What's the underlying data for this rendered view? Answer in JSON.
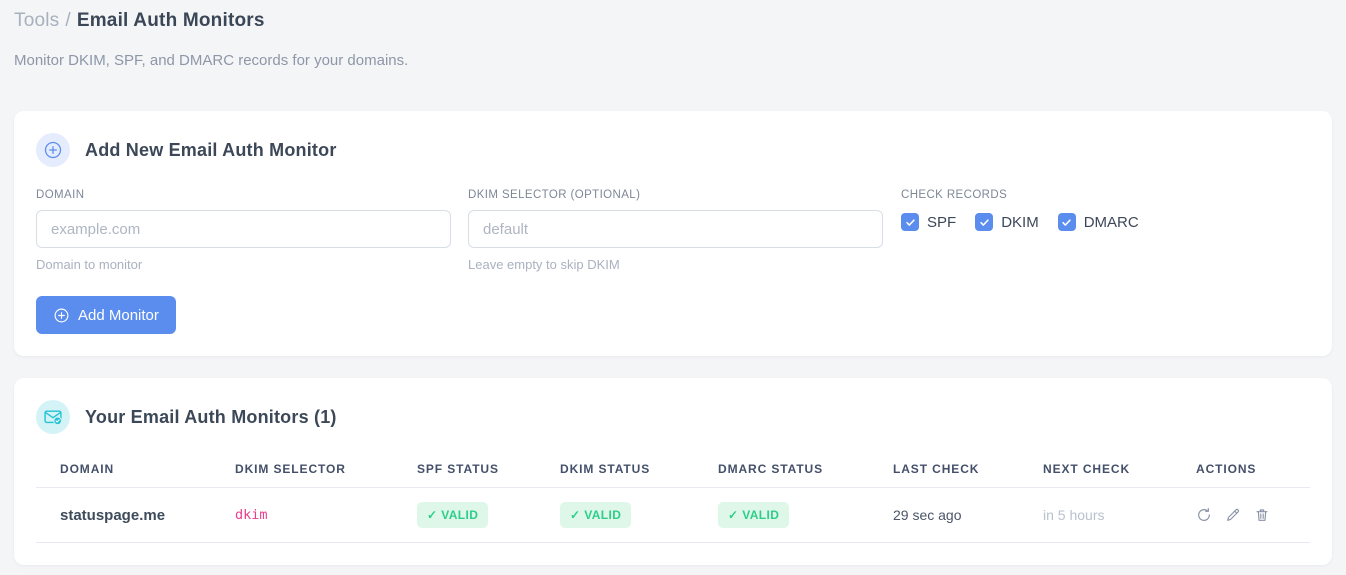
{
  "colors": {
    "accent_blue": "#5a8dee",
    "accent_teal": "#25c2d6",
    "success_text": "#2dce89",
    "success_bg": "#def7e9",
    "code_pink": "#e83e8c",
    "page_bg": "#f4f5f7"
  },
  "breadcrumb": {
    "section": "Tools",
    "separator": "/",
    "current": "Email Auth Monitors"
  },
  "page_subtitle": "Monitor DKIM, SPF, and DMARC records for your domains.",
  "add_monitor_card": {
    "title": "Add New Email Auth Monitor",
    "icon": "plus-circle-icon",
    "fields": {
      "domain": {
        "label": "DOMAIN",
        "value": "",
        "placeholder": "example.com",
        "helper": "Domain to monitor"
      },
      "dkim_selector": {
        "label": "DKIM SELECTOR (OPTIONAL)",
        "value": "",
        "placeholder": "default",
        "helper": "Leave empty to skip DKIM"
      }
    },
    "check_records": {
      "label": "CHECK RECORDS",
      "options": [
        {
          "label": "SPF",
          "checked": true
        },
        {
          "label": "DKIM",
          "checked": true
        },
        {
          "label": "DMARC",
          "checked": true
        }
      ]
    },
    "submit_label": "Add Monitor"
  },
  "monitors_card": {
    "title": "Your Email Auth Monitors (1)",
    "icon": "email-check-icon",
    "table": {
      "columns": [
        "DOMAIN",
        "DKIM SELECTOR",
        "SPF STATUS",
        "DKIM STATUS",
        "DMARC STATUS",
        "LAST CHECK",
        "NEXT CHECK",
        "ACTIONS"
      ],
      "rows": [
        {
          "domain": "statuspage.me",
          "dkim_selector": "dkim",
          "spf_status": "✓ VALID",
          "dkim_status": "✓ VALID",
          "dmarc_status": "✓ VALID",
          "last_check": "29 sec ago",
          "next_check": "in 5 hours",
          "actions": [
            "refresh-icon",
            "edit-icon",
            "delete-icon"
          ]
        }
      ]
    }
  }
}
